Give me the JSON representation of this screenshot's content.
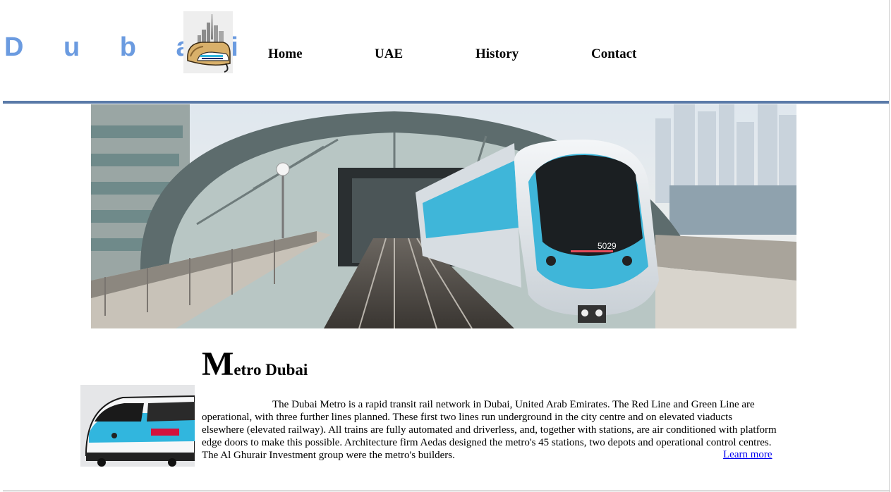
{
  "header": {
    "brand": "D u b a i",
    "nav": [
      {
        "label": "Home"
      },
      {
        "label": "UAE"
      },
      {
        "label": "History"
      },
      {
        "label": "Contact"
      }
    ]
  },
  "hero": {
    "train_number": "5029"
  },
  "article": {
    "title_initial": "M",
    "title_rest": "etro Dubai",
    "body": "The Dubai Metro is a rapid transit rail network in Dubai, United Arab Emirates. The Red Line and Green Line are operational, with three further lines planned. These first two lines run underground in the city centre and on elevated viaducts elsewhere (elevated railway). All trains are fully automated and driverless, and, together with stations, are air conditioned with platform edge doors to make this possible. Architecture firm Aedas designed the metro's 45 stations, two depots and operational control centres. The Al Ghurair Investment group were the metro's builders.",
    "learn_more": "Learn more"
  },
  "colors": {
    "brand": "#6b9be0",
    "header_rule": "#5a7aa8",
    "link": "#0000ee",
    "train_accent": "#31b6de"
  }
}
